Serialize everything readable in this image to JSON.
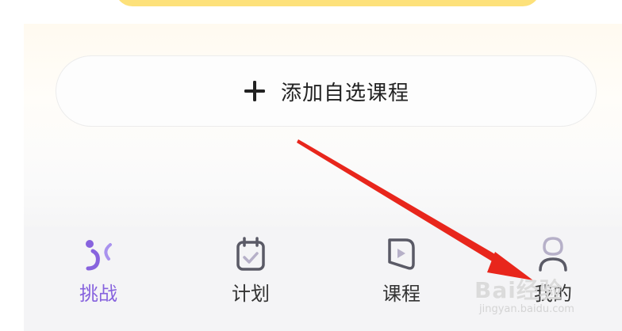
{
  "add_button": {
    "label": "添加自选课程",
    "icon": "plus-icon"
  },
  "tabbar": {
    "items": [
      {
        "label": "挑战",
        "icon": "challenge-runner-icon",
        "active": true
      },
      {
        "label": "计划",
        "icon": "plan-clipboard-icon",
        "active": false
      },
      {
        "label": "课程",
        "icon": "course-play-icon",
        "active": false
      },
      {
        "label": "我的",
        "icon": "profile-person-icon",
        "active": false
      }
    ]
  },
  "colors": {
    "active_tab": "#8763de",
    "inactive_tab": "#333333",
    "banner_yellow": "#fde17a",
    "arrow": "#e8261c"
  },
  "watermark": {
    "main": "Bai经验",
    "sub": "jingyan.baidu.com"
  }
}
